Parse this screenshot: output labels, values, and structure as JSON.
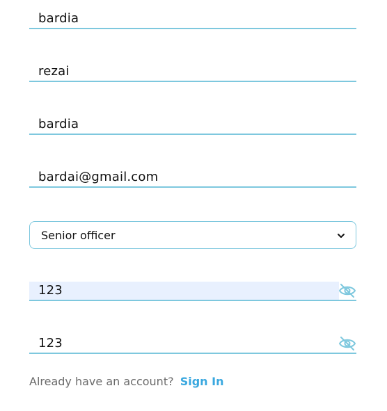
{
  "form": {
    "first_name": {
      "value": "bardia"
    },
    "last_name": {
      "value": "rezai"
    },
    "username": {
      "value": "bardia"
    },
    "email": {
      "value": "bardai@gmail.com"
    },
    "role_select": {
      "selected": "Senior officer",
      "icon": "chevron-down-icon"
    },
    "password": {
      "value": "123",
      "icon": "eye-off-icon"
    },
    "confirm_password": {
      "value": "123",
      "icon": "eye-off-icon"
    }
  },
  "footer": {
    "prompt": "Already have an account?",
    "link": "Sign In"
  },
  "colors": {
    "underline": "#7ec8de",
    "link": "#3aa8df",
    "autofill": "#e8f0fe",
    "icon": "#7ec8de"
  }
}
